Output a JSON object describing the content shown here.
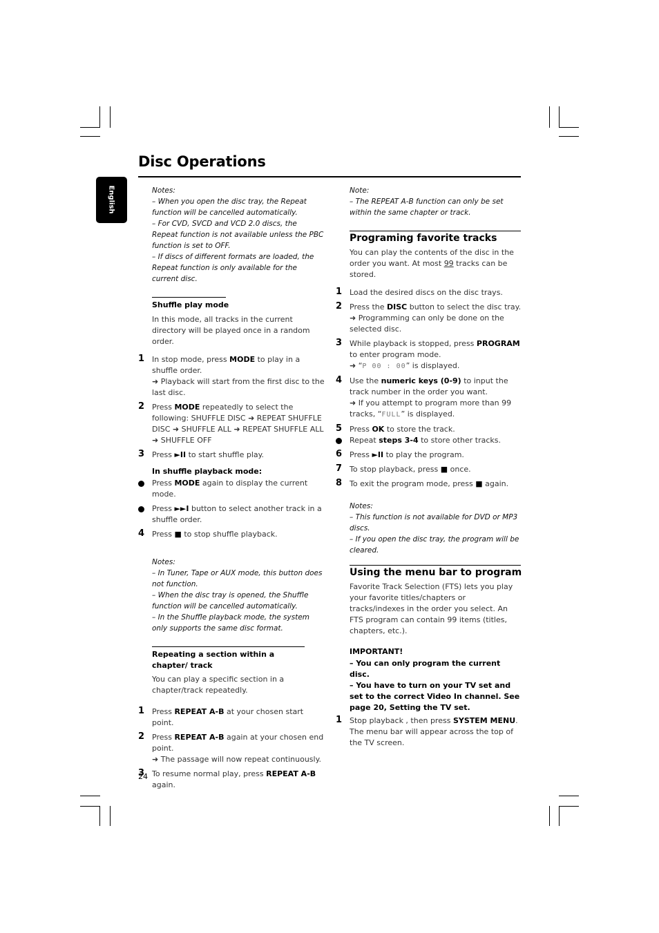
{
  "page": {
    "title": "Disc Operations",
    "language_tab": "English",
    "page_number": "24"
  },
  "left": {
    "notes1": {
      "label": "Notes:",
      "items": [
        "–  When you open the disc tray, the Repeat function will be cancelled automatically.",
        "–  For CVD, SVCD and VCD 2.0 discs, the Repeat function is not available unless the PBC function is set to OFF.",
        "–  If discs of different formats are loaded, the Repeat function is only available for the current disc."
      ]
    },
    "shuffle": {
      "heading": "Shuffle play mode",
      "intro": "In this mode, all tracks in the current directory will be played once in a random order.",
      "steps": [
        {
          "num": "1",
          "pre": "In stop mode, press ",
          "bold": "MODE",
          "post": " to play in a shuffle order.",
          "result": "➜ Playback will start from the first disc to the last disc."
        },
        {
          "num": "2",
          "pre": "Press ",
          "bold": "MODE",
          "post": " repeatedly to select the following: SHUFFLE DISC ➜ REPEAT SHUFFLE DISC ➜ SHUFFLE ALL ➜ REPEAT SHUFFLE ALL ➜ SHUFFLE OFF"
        },
        {
          "num": "3",
          "pre": "Press ",
          "icon": "►II",
          "post": " to start shuffle play."
        }
      ],
      "playback_heading": "In shuffle playback mode:",
      "bullets": [
        {
          "pre": "Press ",
          "bold": "MODE",
          "post": " again to display the current mode."
        },
        {
          "pre": "Press ",
          "icon": "►►I",
          "post": " button to select another track in a shuffle order."
        }
      ],
      "step4": {
        "num": "4",
        "pre": "Press ",
        "icon": "■",
        "post": " to stop shuffle playback."
      }
    },
    "notes2": {
      "label": "Notes:",
      "items": [
        "–  In Tuner, Tape or AUX mode, this button does not function.",
        "–  When the disc tray is opened, the Shuffle function will be cancelled automatically.",
        "–  In the Shuffle playback mode, the system only supports the same disc format."
      ]
    },
    "repeat_ab": {
      "heading": "Repeating a section within a chapter/ track",
      "intro": "You can play a specific section in a chapter/track repeatedly.",
      "steps": [
        {
          "num": "1",
          "pre": "Press ",
          "bold": "REPEAT A-B",
          "post": " at your chosen start point."
        },
        {
          "num": "2",
          "pre": "Press ",
          "bold": "REPEAT A-B",
          "post": " again at your chosen end point.",
          "result": "➜ The passage will now repeat continuously."
        },
        {
          "num": "3",
          "pre": "To resume normal play, press ",
          "bold": "REPEAT A-B",
          "post": " again."
        }
      ]
    }
  },
  "right": {
    "note": {
      "label": "Note:",
      "items": [
        "–  The REPEAT A-B function can only be set within the same chapter or track."
      ]
    },
    "programming": {
      "heading": "Programing favorite tracks",
      "intro_pre": "You can play the contents of the disc in the order you want. At most ",
      "intro_underline": "99",
      "intro_post": " tracks can be stored.",
      "steps": [
        {
          "num": "1",
          "text": "Load the desired discs on the disc trays."
        },
        {
          "num": "2",
          "pre": "Press the ",
          "bold": "DISC",
          "post": " button to select the disc tray.",
          "result": "➜ Programming can only be done on the selected disc."
        },
        {
          "num": "3",
          "pre": "While playback is stopped, press ",
          "bold": "PROGRAM",
          "post": " to enter program mode.",
          "result_pre": "➜ “",
          "result_lcd": "P  00 : 00",
          "result_post": "” is displayed."
        },
        {
          "num": "4",
          "pre": "Use the ",
          "bold": "numeric keys (0-9)",
          "post": " to input the track number in the order you want.",
          "result_pre": "➜ If you attempt to program more than 99 tracks, “",
          "result_lcd": "FULL",
          "result_post": "” is displayed."
        },
        {
          "num": "5",
          "pre": "Press ",
          "bold": "OK",
          "post": " to store the track."
        },
        {
          "bullet": true,
          "pre": "Repeat ",
          "bold": "steps 3-4",
          "post": " to store other tracks."
        },
        {
          "num": "6",
          "pre": "Press ",
          "icon": "►II",
          "post": " to play the program."
        },
        {
          "num": "7",
          "pre": "To stop playback, press ",
          "icon": "■",
          "post": " once."
        },
        {
          "num": "8",
          "pre": "To exit the program mode, press ",
          "icon": "■",
          "post": " again."
        }
      ]
    },
    "notes": {
      "label": "Notes:",
      "items": [
        "–  This function is not available for DVD or MP3 discs.",
        "–  If you open the disc tray, the program will be cleared."
      ]
    },
    "menu_bar": {
      "heading": "Using the menu bar to program",
      "intro": "Favorite Track Selection (FTS) lets you play your favorite titles/chapters or tracks/indexes in the order you select. An FTS program can contain 99 items (titles, chapters, etc.).",
      "important_label": "IMPORTANT!",
      "important_items": [
        "–   You can only program the current disc.",
        "–   You have to turn on your TV set and set to the correct Video In channel.  See page 20, Setting the TV set."
      ],
      "step1": {
        "num": "1",
        "pre": "Stop playback , then press ",
        "bold": "SYSTEM MENU",
        "post": ".",
        "result": "The menu bar will appear across the top of the TV screen."
      }
    }
  }
}
